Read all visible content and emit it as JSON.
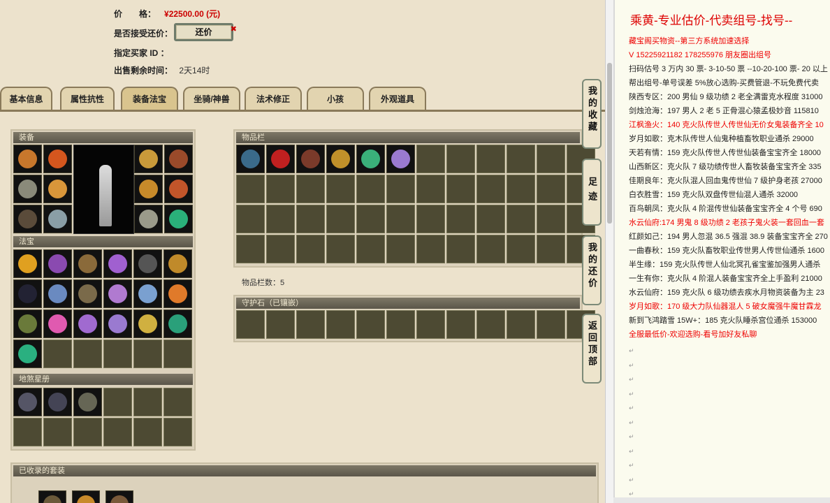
{
  "listing": {
    "price_label": "价　　格：",
    "price_value": "¥22500.00 (元)",
    "accept_label": "是否接受还价：",
    "counter_button": "还价",
    "buyer_label": "指定买家 ID ：",
    "time_label": "出售剩余时间：",
    "time_value": "2天14时"
  },
  "tabs": [
    "基本信息",
    "属性抗性",
    "装备法宝",
    "坐骑/神兽",
    "法术修正",
    "小孩",
    "外观道具"
  ],
  "panels": {
    "equipment": "装备",
    "treasure": "法宝",
    "starbook": "地煞星册",
    "inventory": "物品栏",
    "inventory_count": "物品栏数：5",
    "guardstone": "守护石（已镶嵌）",
    "collected_sets": "已收录的套装"
  },
  "side_buttons": [
    "我的收藏",
    "足迹",
    "我的还价",
    "返回顶部"
  ],
  "doc": {
    "title": "乘黄-专业估价-代卖组号-找号--",
    "lines": [
      {
        "text": "藏宝阁买物资--第三方系统加速选择",
        "red": true
      },
      {
        "text": "V 15225921182 178255976 朋友圈出组号",
        "red": true
      },
      {
        "text": "扫码估号 3 万内 30 票- 3-10-50 票  --10-20-100 票- 20 以上",
        "red": false
      },
      {
        "text": "帮出组号-单号误差 5%放心选购-买费管退-不玩免费代卖",
        "red": false
      },
      {
        "text": "陕西专区：200 男仙 9 级功绩 2 老全满雷克水程度 31000",
        "red": false
      },
      {
        "text": "剑烛沧海：197 男人 2 老 5 正骨混心猿孟极妙音 115810",
        "red": false
      },
      {
        "text": "江枫渔火：140 克火队传世人传世仙无价女鬼装备齐全 10",
        "red": true
      },
      {
        "text": "岁月如歌：克木队传世人仙鬼种植畜牧职业通杀 29000",
        "red": false
      },
      {
        "text": "天若有情：159 克火队传世人传世仙装备宝宝齐全 18000",
        "red": false
      },
      {
        "text": "山西新区：克火队 7 级功绩传世人畜牧装备宝宝齐全 335",
        "red": false
      },
      {
        "text": "佳期良年：克火队混人回血鬼传世仙 7 级护身老孩 27000",
        "red": false
      },
      {
        "text": "白衣胜雪：159 克火队双盘传世仙混人通杀 32000",
        "red": false
      },
      {
        "text": "百鸟朝凤：克火队 4 阶混传世仙装备宝宝齐全 4 个号 690",
        "red": false
      },
      {
        "text": "水云仙府:174 男鬼 8 级功绩 2 老孩子鬼火装一套回血一套",
        "red": true
      },
      {
        "text": "红颜如己：194 男人忽混 36.5 强混 38.9 装备宝宝齐全 270",
        "red": false
      },
      {
        "text": "一曲春秋：159 克火队畜牧职业传世男人传世仙通杀 1600",
        "red": false
      },
      {
        "text": "半生缘：159 克火队传世人仙北冥孔雀宝鉴加强男人通杀",
        "red": false
      },
      {
        "text": "一生有你：克火队 4 阶混人装备宝宝齐全上手盈利 21000",
        "red": false
      },
      {
        "text": "水云仙府：159 克火队 6 级功绩去疾水月物资装备为主 23",
        "red": false
      },
      {
        "text": "岁月如歌：170 级大力队仙器混人 5 破女魔强牛魔甘霖龙",
        "red": true
      },
      {
        "text": "新到飞鸿踏雪 15W+：185 克火队睡杀宫位通杀 153000",
        "red": false
      },
      {
        "text": "全服最低价-欢迎选购-看号加好友私聊",
        "red": true
      }
    ],
    "empty_mark": "↵"
  },
  "colors": {
    "price_red": "#cc0000",
    "panel_head": "#5b5649",
    "grid_cell": "#4d4a33"
  }
}
